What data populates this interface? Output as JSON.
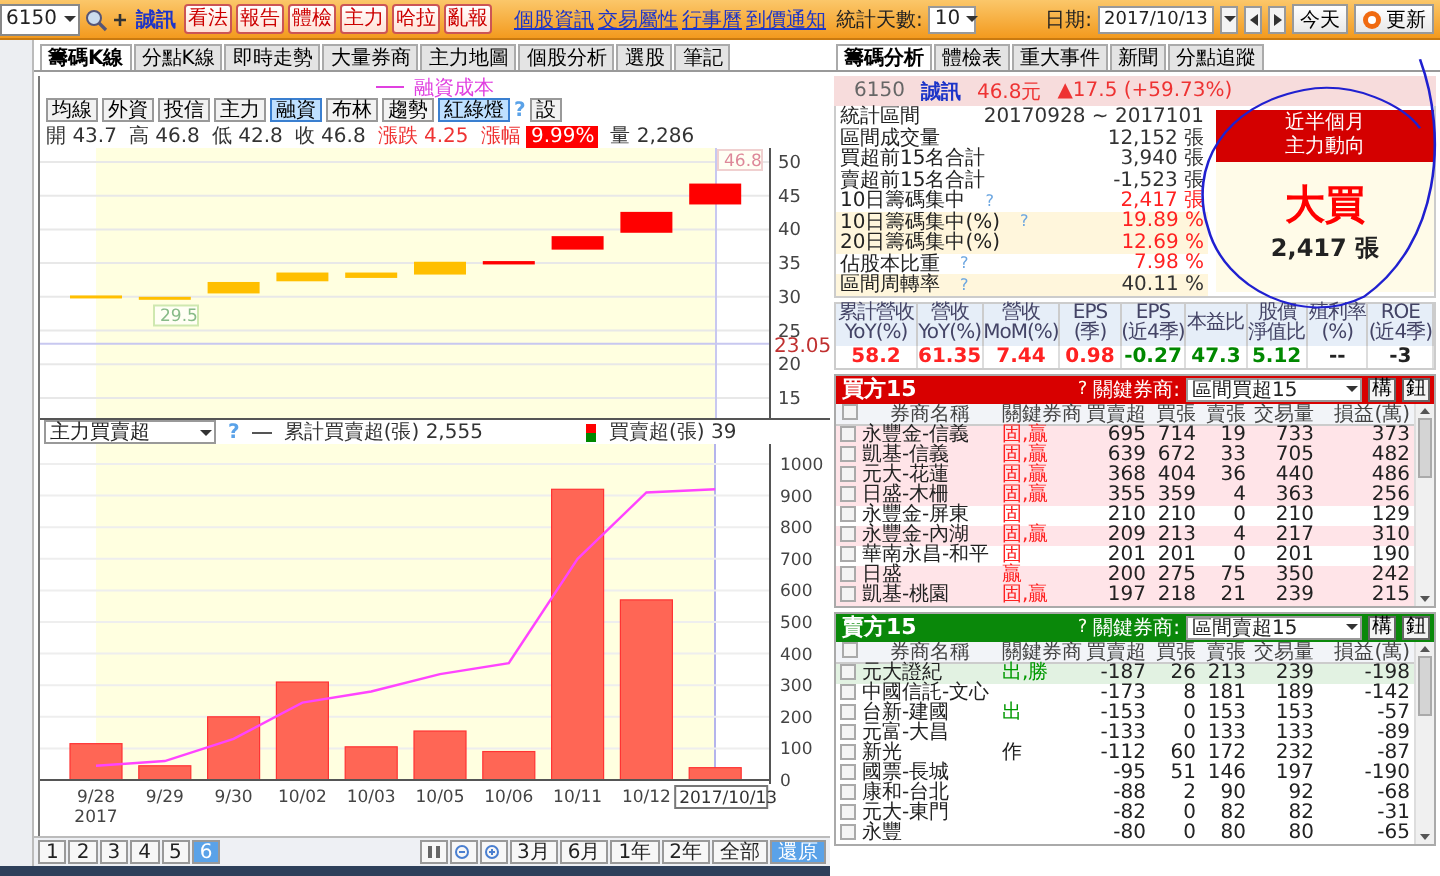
{
  "toolbar": {
    "symbol": "6150",
    "stock_name": "誠訊",
    "buttons": [
      "看法",
      "報告",
      "體檢",
      "主力",
      "哈拉",
      "亂報"
    ],
    "links": [
      "個股資訊",
      "交易屬性",
      "行事曆",
      "到價通知"
    ]
  },
  "chart_tabs": [
    {
      "label": "籌碼K線",
      "selected": true
    },
    {
      "label": "分點K線",
      "selected": false
    },
    {
      "label": "即時走勢",
      "selected": false
    },
    {
      "label": "大量券商",
      "selected": false
    },
    {
      "label": "主力地圖",
      "selected": false
    },
    {
      "label": "個股分析",
      "selected": false
    },
    {
      "label": "選股",
      "selected": false
    },
    {
      "label": "筆記",
      "selected": false
    }
  ],
  "legend": "融資成本",
  "indicator_buttons": [
    {
      "label": "均線",
      "selected": false
    },
    {
      "label": "外資",
      "selected": false
    },
    {
      "label": "投信",
      "selected": false
    },
    {
      "label": "主力",
      "selected": false
    },
    {
      "label": "融資",
      "selected": true
    },
    {
      "label": "布林",
      "selected": false
    },
    {
      "label": "趨勢",
      "selected": false
    },
    {
      "label": "紅綠燈",
      "selected": true
    }
  ],
  "indicator_help": "?",
  "settings_button": "設",
  "ohlc": [
    {
      "label": "開",
      "value": "43.7",
      "kind": "plain"
    },
    {
      "label": "高",
      "value": "46.8",
      "kind": "plain"
    },
    {
      "label": "低",
      "value": "42.8",
      "kind": "plain"
    },
    {
      "label": "收",
      "value": "46.8",
      "kind": "plain"
    },
    {
      "label": "漲跌",
      "value": "4.25",
      "kind": "change"
    },
    {
      "label": "漲幅",
      "value": "9.99%",
      "kind": "limit"
    },
    {
      "label": "量",
      "value": "2,286",
      "kind": "plain"
    }
  ],
  "price_chart": {
    "yticks": [
      "50",
      "45",
      "40",
      "35",
      "30",
      "25",
      "20",
      "15"
    ],
    "reference": "23.05",
    "low_label": "29.5",
    "high_label": "46.8"
  },
  "flow_chart": {
    "indicator": "主力買賣超",
    "help": "?",
    "cumulative_total": "2,555",
    "daily_value": "39",
    "year_label": "2017",
    "chart_data": {
      "type": "bar",
      "grid": true,
      "categories": [
        "9/28",
        "9/29",
        "9/30",
        "10/02",
        "10/03",
        "10/05",
        "10/06",
        "10/11",
        "10/12",
        "2017/10/13"
      ],
      "ylim": [
        0,
        1000
      ],
      "yticks": [
        0,
        100,
        200,
        300,
        400,
        500,
        600,
        700,
        800,
        900,
        1000
      ],
      "series": [
        {
          "name": "累計買賣超(張)",
          "type": "line",
          "color": "#ff44ff",
          "values": [
            45,
            60,
            130,
            245,
            280,
            335,
            370,
            700,
            910,
            920
          ]
        },
        {
          "name": "買賣超(張)",
          "type": "bar",
          "color": "#ff6655",
          "values": [
            115,
            45,
            200,
            310,
            105,
            155,
            90,
            920,
            570,
            39
          ]
        }
      ]
    }
  },
  "pager": {
    "pages": [
      {
        "label": "1",
        "selected": false
      },
      {
        "label": "2",
        "selected": false
      },
      {
        "label": "3",
        "selected": false
      },
      {
        "label": "4",
        "selected": false
      },
      {
        "label": "5",
        "selected": false
      },
      {
        "label": "6",
        "selected": true
      }
    ],
    "ranges": [
      {
        "label": "3月",
        "selected": false
      },
      {
        "label": "6月",
        "selected": false
      },
      {
        "label": "1年",
        "selected": false
      },
      {
        "label": "2年",
        "selected": false
      },
      {
        "label": "全部",
        "selected": false
      },
      {
        "label": "還原",
        "selected": true
      }
    ]
  },
  "stats_toolbar": {
    "days_label": "統計天數:",
    "days": "10",
    "date_label": "日期:",
    "date": "2017/10/13",
    "today_button": "今天",
    "refresh_button": "更新"
  },
  "panel_tabs": [
    {
      "label": "籌碼分析",
      "selected": true
    },
    {
      "label": "體檢表",
      "selected": false
    },
    {
      "label": "重大事件",
      "selected": false
    },
    {
      "label": "新聞",
      "selected": false
    },
    {
      "label": "分點追蹤",
      "selected": false
    }
  ],
  "quote": {
    "symbol": "6150",
    "name": "誠訊",
    "price": "46.8元",
    "change": "▲17.5 (+59.73%)"
  },
  "stats": [
    {
      "label": "統計區間",
      "value": "20170928 ~ 2017101",
      "emphasized": false,
      "shaded": false
    },
    {
      "label": "區間成交量",
      "value": "12,152 張",
      "emphasized": false,
      "shaded": false
    },
    {
      "label": "買超前15名合計",
      "value": "3,940 張",
      "emphasized": false,
      "shaded": false
    },
    {
      "label": "賣超前15名合計",
      "value": "-1,523 張",
      "emphasized": false,
      "shaded": false
    },
    {
      "label": "10日籌碼集中",
      "help": "?",
      "value": "2,417 張",
      "emphasized": true,
      "shaded": false
    },
    {
      "label": "10日籌碼集中(%)",
      "help": "?",
      "value": "19.89 %",
      "emphasized": true,
      "shaded": true
    },
    {
      "label": "20日籌碼集中(%)",
      "value": "12.69 %",
      "emphasized": true,
      "shaded": true
    },
    {
      "label": "佔股本比重",
      "help": "?",
      "value": "7.98 %",
      "emphasized": true,
      "shaded": false
    },
    {
      "label": "區間周轉率",
      "help": "?",
      "value": "40.11 %",
      "emphasized": false,
      "shaded": true
    }
  ],
  "trend_box": {
    "title_lines": [
      "近半個月",
      "主力動向"
    ],
    "verdict": "大買",
    "amount": "2,417 張"
  },
  "financials": [
    {
      "lines": [
        "累計營收",
        "YoY(%)"
      ],
      "value": "58.2",
      "color": "#ff2222"
    },
    {
      "lines": [
        "營收",
        "YoY(%)"
      ],
      "value": "61.35",
      "color": "#ff2222"
    },
    {
      "lines": [
        "營收",
        "MoM(%)"
      ],
      "value": "7.44",
      "color": "#ff2222"
    },
    {
      "lines": [
        "EPS",
        "(季)"
      ],
      "value": "0.98",
      "color": "#ff2222"
    },
    {
      "lines": [
        "EPS",
        "(近4季)"
      ],
      "value": "-0.27",
      "color": "#008800"
    },
    {
      "lines": [
        "本益比"
      ],
      "value": "47.3",
      "color": "#008800"
    },
    {
      "lines": [
        "股價",
        "淨值比"
      ],
      "value": "5.12",
      "color": "#008800"
    },
    {
      "lines": [
        "殖利率",
        "(%)"
      ],
      "value": "--",
      "color": "#222222"
    },
    {
      "lines": [
        "ROE",
        "(近4季)"
      ],
      "value": "-3",
      "color": "#222222"
    }
  ],
  "broker_tables": [
    {
      "kind": "buy",
      "title": "買方15",
      "help": "?",
      "filter_label": "關鍵券商:",
      "filter": "區間買超15",
      "buttons": [
        "構",
        "鈕"
      ],
      "all_checked": false,
      "columns": [
        "券商名稱",
        "關鍵券商",
        "買賣超",
        "買張",
        "賣張",
        "交易量",
        "損益(萬)"
      ],
      "rows": [
        {
          "checked": false,
          "highlighted": true,
          "color": "#ff2222",
          "cells": [
            "永豐金-信義",
            "固,贏",
            "695",
            "714",
            "19",
            "733",
            "373"
          ]
        },
        {
          "checked": false,
          "highlighted": true,
          "color": "#ff2222",
          "cells": [
            "凱基-信義",
            "固,贏",
            "639",
            "672",
            "33",
            "705",
            "482"
          ]
        },
        {
          "checked": false,
          "highlighted": true,
          "color": "#ff2222",
          "cells": [
            "元大-花蓮",
            "固,贏",
            "368",
            "404",
            "36",
            "440",
            "486"
          ]
        },
        {
          "checked": false,
          "highlighted": true,
          "color": "#ff2222",
          "cells": [
            "日盛-木柵",
            "固,贏",
            "355",
            "359",
            "4",
            "363",
            "256"
          ]
        },
        {
          "checked": false,
          "highlighted": false,
          "color": "#ff2222",
          "cells": [
            "永豐金-屏東",
            "固",
            "210",
            "210",
            "0",
            "210",
            "129"
          ]
        },
        {
          "checked": false,
          "highlighted": true,
          "color": "#ff2222",
          "cells": [
            "永豐金-內湖",
            "固,贏",
            "209",
            "213",
            "4",
            "217",
            "310"
          ]
        },
        {
          "checked": false,
          "highlighted": false,
          "color": "#ff2222",
          "cells": [
            "華南永昌-和平",
            "固",
            "201",
            "201",
            "0",
            "201",
            "190"
          ]
        },
        {
          "checked": false,
          "highlighted": true,
          "color": "#ff2222",
          "cells": [
            "日盛",
            "贏",
            "200",
            "275",
            "75",
            "350",
            "242"
          ]
        },
        {
          "checked": false,
          "highlighted": true,
          "color": "#ff2222",
          "cells": [
            "凱基-桃園",
            "固,贏",
            "197",
            "218",
            "21",
            "239",
            "215"
          ]
        }
      ]
    },
    {
      "kind": "sell",
      "title": "賣方15",
      "help": "?",
      "filter_label": "關鍵券商:",
      "filter": "區間賣超15",
      "buttons": [
        "構",
        "鈕"
      ],
      "all_checked": false,
      "columns": [
        "券商名稱",
        "關鍵券商",
        "買賣超",
        "買張",
        "賣張",
        "交易量",
        "損益(萬)"
      ],
      "rows": [
        {
          "checked": false,
          "highlighted": true,
          "color": "#009900",
          "cells": [
            "元大證紀",
            "出,勝",
            "-187",
            "26",
            "213",
            "239",
            "-198"
          ]
        },
        {
          "checked": false,
          "highlighted": false,
          "cells": [
            "中國信託-文心",
            "",
            "-173",
            "8",
            "181",
            "189",
            "-142"
          ]
        },
        {
          "checked": false,
          "highlighted": false,
          "color": "#009900",
          "cells": [
            "台新-建國",
            "出",
            "-153",
            "0",
            "153",
            "153",
            "-57"
          ]
        },
        {
          "checked": false,
          "highlighted": false,
          "cells": [
            "元富-大昌",
            "",
            "-133",
            "0",
            "133",
            "133",
            "-89"
          ]
        },
        {
          "checked": false,
          "highlighted": false,
          "color": "#222222",
          "cells": [
            "新光",
            "作",
            "-112",
            "60",
            "172",
            "232",
            "-87"
          ]
        },
        {
          "checked": false,
          "highlighted": false,
          "cells": [
            "國票-長城",
            "",
            "-95",
            "51",
            "146",
            "197",
            "-190"
          ]
        },
        {
          "checked": false,
          "highlighted": false,
          "cells": [
            "康和-台北",
            "",
            "-88",
            "2",
            "90",
            "92",
            "-68"
          ]
        },
        {
          "checked": false,
          "highlighted": false,
          "cells": [
            "元大-東門",
            "",
            "-82",
            "0",
            "82",
            "82",
            "-31"
          ]
        },
        {
          "checked": false,
          "highlighted": false,
          "cells": [
            "永豐",
            "",
            "-80",
            "0",
            "80",
            "80",
            "-65"
          ]
        }
      ]
    }
  ]
}
